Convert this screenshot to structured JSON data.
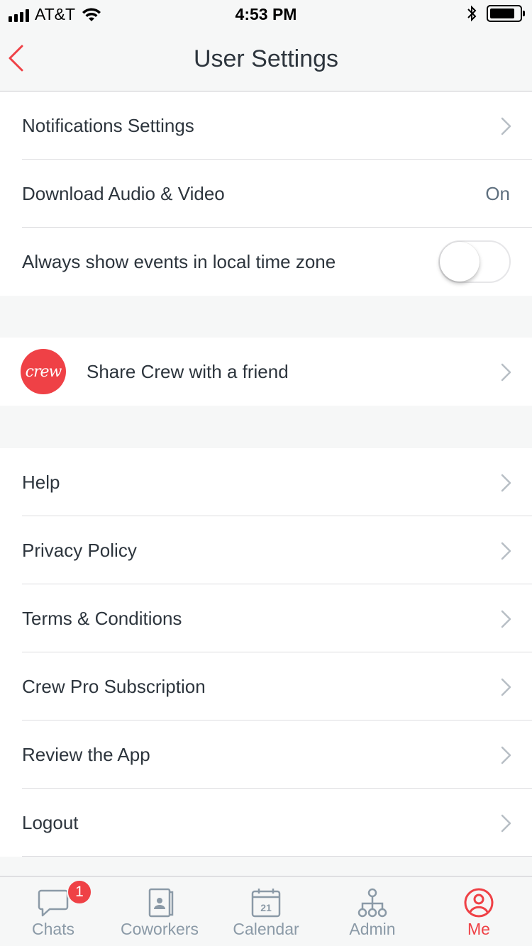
{
  "status_bar": {
    "carrier": "AT&T",
    "time": "4:53 PM"
  },
  "nav": {
    "title": "User Settings"
  },
  "settings": {
    "notifications_label": "Notifications Settings",
    "download_label": "Download Audio & Video",
    "download_value": "On",
    "local_time_label": "Always show events in local time zone",
    "local_time_enabled": false
  },
  "share": {
    "logo_text": "crew",
    "label": "Share Crew with a friend"
  },
  "links": [
    {
      "label": "Help"
    },
    {
      "label": "Privacy Policy"
    },
    {
      "label": "Terms & Conditions"
    },
    {
      "label": "Crew Pro Subscription"
    },
    {
      "label": "Review the App"
    },
    {
      "label": "Logout"
    }
  ],
  "tabs": [
    {
      "label": "Chats",
      "badge": "1"
    },
    {
      "label": "Coworkers"
    },
    {
      "label": "Calendar",
      "calendar_day": "21"
    },
    {
      "label": "Admin"
    },
    {
      "label": "Me",
      "active": true
    }
  ],
  "colors": {
    "accent": "#ef4146",
    "tab_inactive": "#8b9aa7",
    "text": "#2d353d",
    "background": "#f6f7f7"
  }
}
